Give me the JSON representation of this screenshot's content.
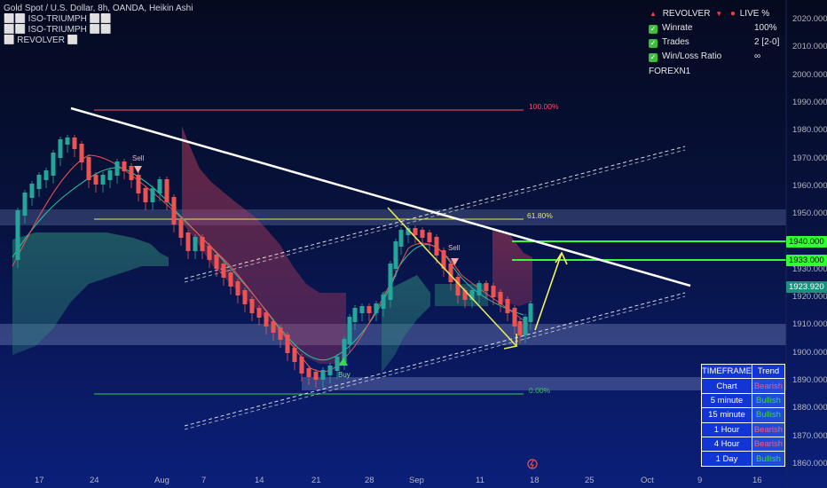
{
  "header": {
    "symbol_line": "Gold Spot / U.S. Dollar, 8h, OANDA, Heikin Ashi",
    "indicators": [
      "⬜⬜ ISO-TRIUMPH ⬜⬜",
      "⬜⬜ ISO-TRIUMPH ⬜⬜",
      "⬜ REVOLVER ⬜"
    ]
  },
  "stats_panel": {
    "title_left": "REVOLVER",
    "title_right": "LIVE %",
    "rows": [
      {
        "label": "Winrate",
        "value": "100%"
      },
      {
        "label": "Trades",
        "value": "2 [2-0]"
      },
      {
        "label": "Win/Loss Ratio",
        "value": "∞"
      }
    ],
    "footer": "FOREXN1"
  },
  "y_axis": {
    "ticks": [
      "2020.000",
      "2010.000",
      "2000.000",
      "1990.000",
      "1980.000",
      "1970.000",
      "1960.000",
      "1950.000",
      "1940.000",
      "1930.000",
      "1920.000",
      "1910.000",
      "1900.000",
      "1890.000",
      "1880.000",
      "1870.000",
      "1860.000"
    ]
  },
  "price_tags": {
    "tp1": "1940.000",
    "tp2": "1933.000",
    "current": "1923.920"
  },
  "x_axis": {
    "ticks": [
      "17",
      "24",
      "Aug",
      "7",
      "14",
      "21",
      "28",
      "Sep",
      "11",
      "18",
      "25",
      "Oct",
      "9",
      "16"
    ]
  },
  "annotations": {
    "fib_100": "100.00%",
    "fib_618": "61.80%",
    "fib_0": "0.00%",
    "sell_1": "Sell",
    "sell_2": "Sell",
    "buy_1": "Buy"
  },
  "timeframe_table": {
    "headers": [
      "TIMEFRAME",
      "Trend"
    ],
    "rows": [
      {
        "tf": "Chart",
        "trend": "Bearish"
      },
      {
        "tf": "5 minute",
        "trend": "Bullish"
      },
      {
        "tf": "15 minute",
        "trend": "Bullish"
      },
      {
        "tf": "1 Hour",
        "trend": "Bearish"
      },
      {
        "tf": "4 Hour",
        "trend": "Bearish"
      },
      {
        "tf": "1 Day",
        "trend": "Bullish"
      }
    ]
  },
  "colors": {
    "bull": "#26a69a",
    "bear": "#ef5350",
    "fib_red": "#ff4d6d",
    "fib_yellow": "#e6e65c",
    "fib_green": "#33cc55",
    "target_green": "#33ff33",
    "trendline": "#ffffff"
  }
}
